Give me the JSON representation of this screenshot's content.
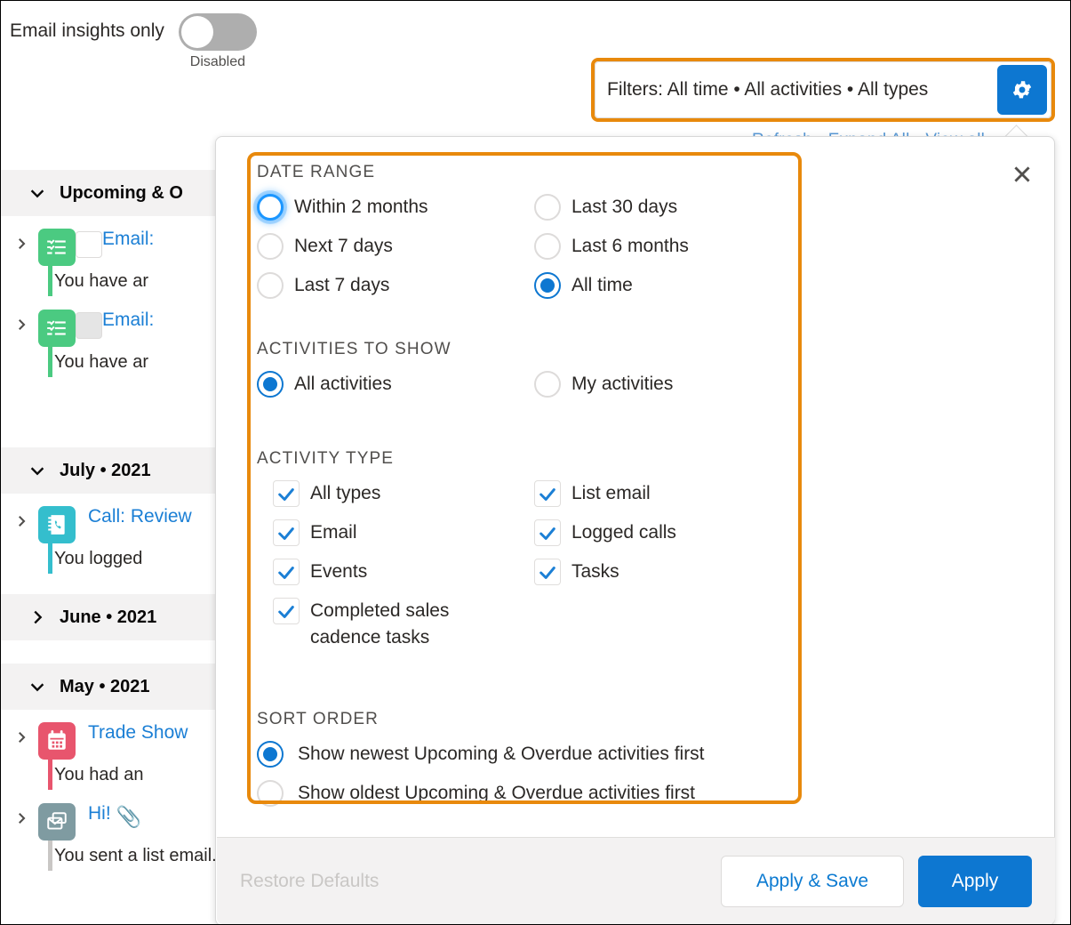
{
  "email_insights": {
    "label": "Email insights only",
    "state_text": "Disabled",
    "enabled": false
  },
  "filter_bar": {
    "summary": "Filters: All time • All activities • All types",
    "gear_icon": "gear-icon"
  },
  "behind_links": "Refresh • Expand All • View all",
  "timeline": {
    "sections": [
      {
        "title": "Upcoming & O",
        "expanded": true
      },
      {
        "title": "July • 2021",
        "expanded": true
      },
      {
        "title": "June • 2021",
        "expanded": false
      },
      {
        "title": "May • 2021",
        "expanded": true
      }
    ],
    "items": [
      {
        "icon": "task-icon",
        "icon_color": "#4bca81",
        "title": "Email:",
        "desc": "You have ar",
        "checkbox": "empty"
      },
      {
        "icon": "task-icon",
        "icon_color": "#4bca81",
        "title": "Email:",
        "desc": "You have ar",
        "checkbox": "greyed"
      },
      {
        "icon": "call-icon",
        "icon_color": "#34becd",
        "title": "Call: Review",
        "desc": "You logged",
        "checkbox": "none"
      },
      {
        "icon": "event-icon",
        "icon_color": "#e8556d",
        "title": "Trade Show",
        "desc": "You had an",
        "checkbox": "none"
      },
      {
        "icon": "list-email-icon",
        "icon_color": "#7f9ba1",
        "title": "Hi!",
        "desc": "You sent a list email.",
        "checkbox": "none",
        "attachment": "paperclip-icon"
      }
    ]
  },
  "popover": {
    "close_icon": "close-icon",
    "groups": [
      {
        "id": "date_range",
        "title": "DATE RANGE",
        "type": "radio",
        "left_options": [
          {
            "label": "Within 2 months",
            "selected": false,
            "focused": true
          },
          {
            "label": "Next 7 days",
            "selected": false,
            "focused": false
          },
          {
            "label": "Last 7 days",
            "selected": false,
            "focused": false
          }
        ],
        "right_options": [
          {
            "label": "Last 30 days",
            "selected": false,
            "focused": false
          },
          {
            "label": "Last 6 months",
            "selected": false,
            "focused": false
          },
          {
            "label": "All time",
            "selected": true,
            "focused": false
          }
        ]
      },
      {
        "id": "activities_to_show",
        "title": "ACTIVITIES TO SHOW",
        "type": "radio",
        "left_options": [
          {
            "label": "All activities",
            "selected": true,
            "focused": false
          }
        ],
        "right_options": [
          {
            "label": "My activities",
            "selected": false,
            "focused": false
          }
        ]
      },
      {
        "id": "activity_type",
        "title": "ACTIVITY TYPE",
        "type": "checkbox",
        "left_options": [
          {
            "label": "All types",
            "checked": true
          },
          {
            "label": "Email",
            "checked": true
          },
          {
            "label": "Events",
            "checked": true
          },
          {
            "label": "Completed sales cadence tasks",
            "checked": true
          }
        ],
        "right_options": [
          {
            "label": "List email",
            "checked": true
          },
          {
            "label": "Logged calls",
            "checked": true
          },
          {
            "label": "Tasks",
            "checked": true
          }
        ]
      }
    ],
    "sort_order": {
      "title": "SORT ORDER",
      "options": [
        {
          "label": "Show newest Upcoming & Overdue activities first",
          "selected": true
        },
        {
          "label": "Show oldest Upcoming & Overdue activities first",
          "selected": false
        }
      ]
    },
    "footer": {
      "restore_label": "Restore Defaults",
      "restore_disabled": true,
      "apply_save_label": "Apply & Save",
      "apply_label": "Apply"
    }
  },
  "colors": {
    "accent_blue": "#0d77d1",
    "link_blue": "#1b7fd5",
    "highlight_orange": "#e8890c",
    "footer_grey": "#f3f2f2",
    "disabled_grey": "#c9c7c5"
  }
}
